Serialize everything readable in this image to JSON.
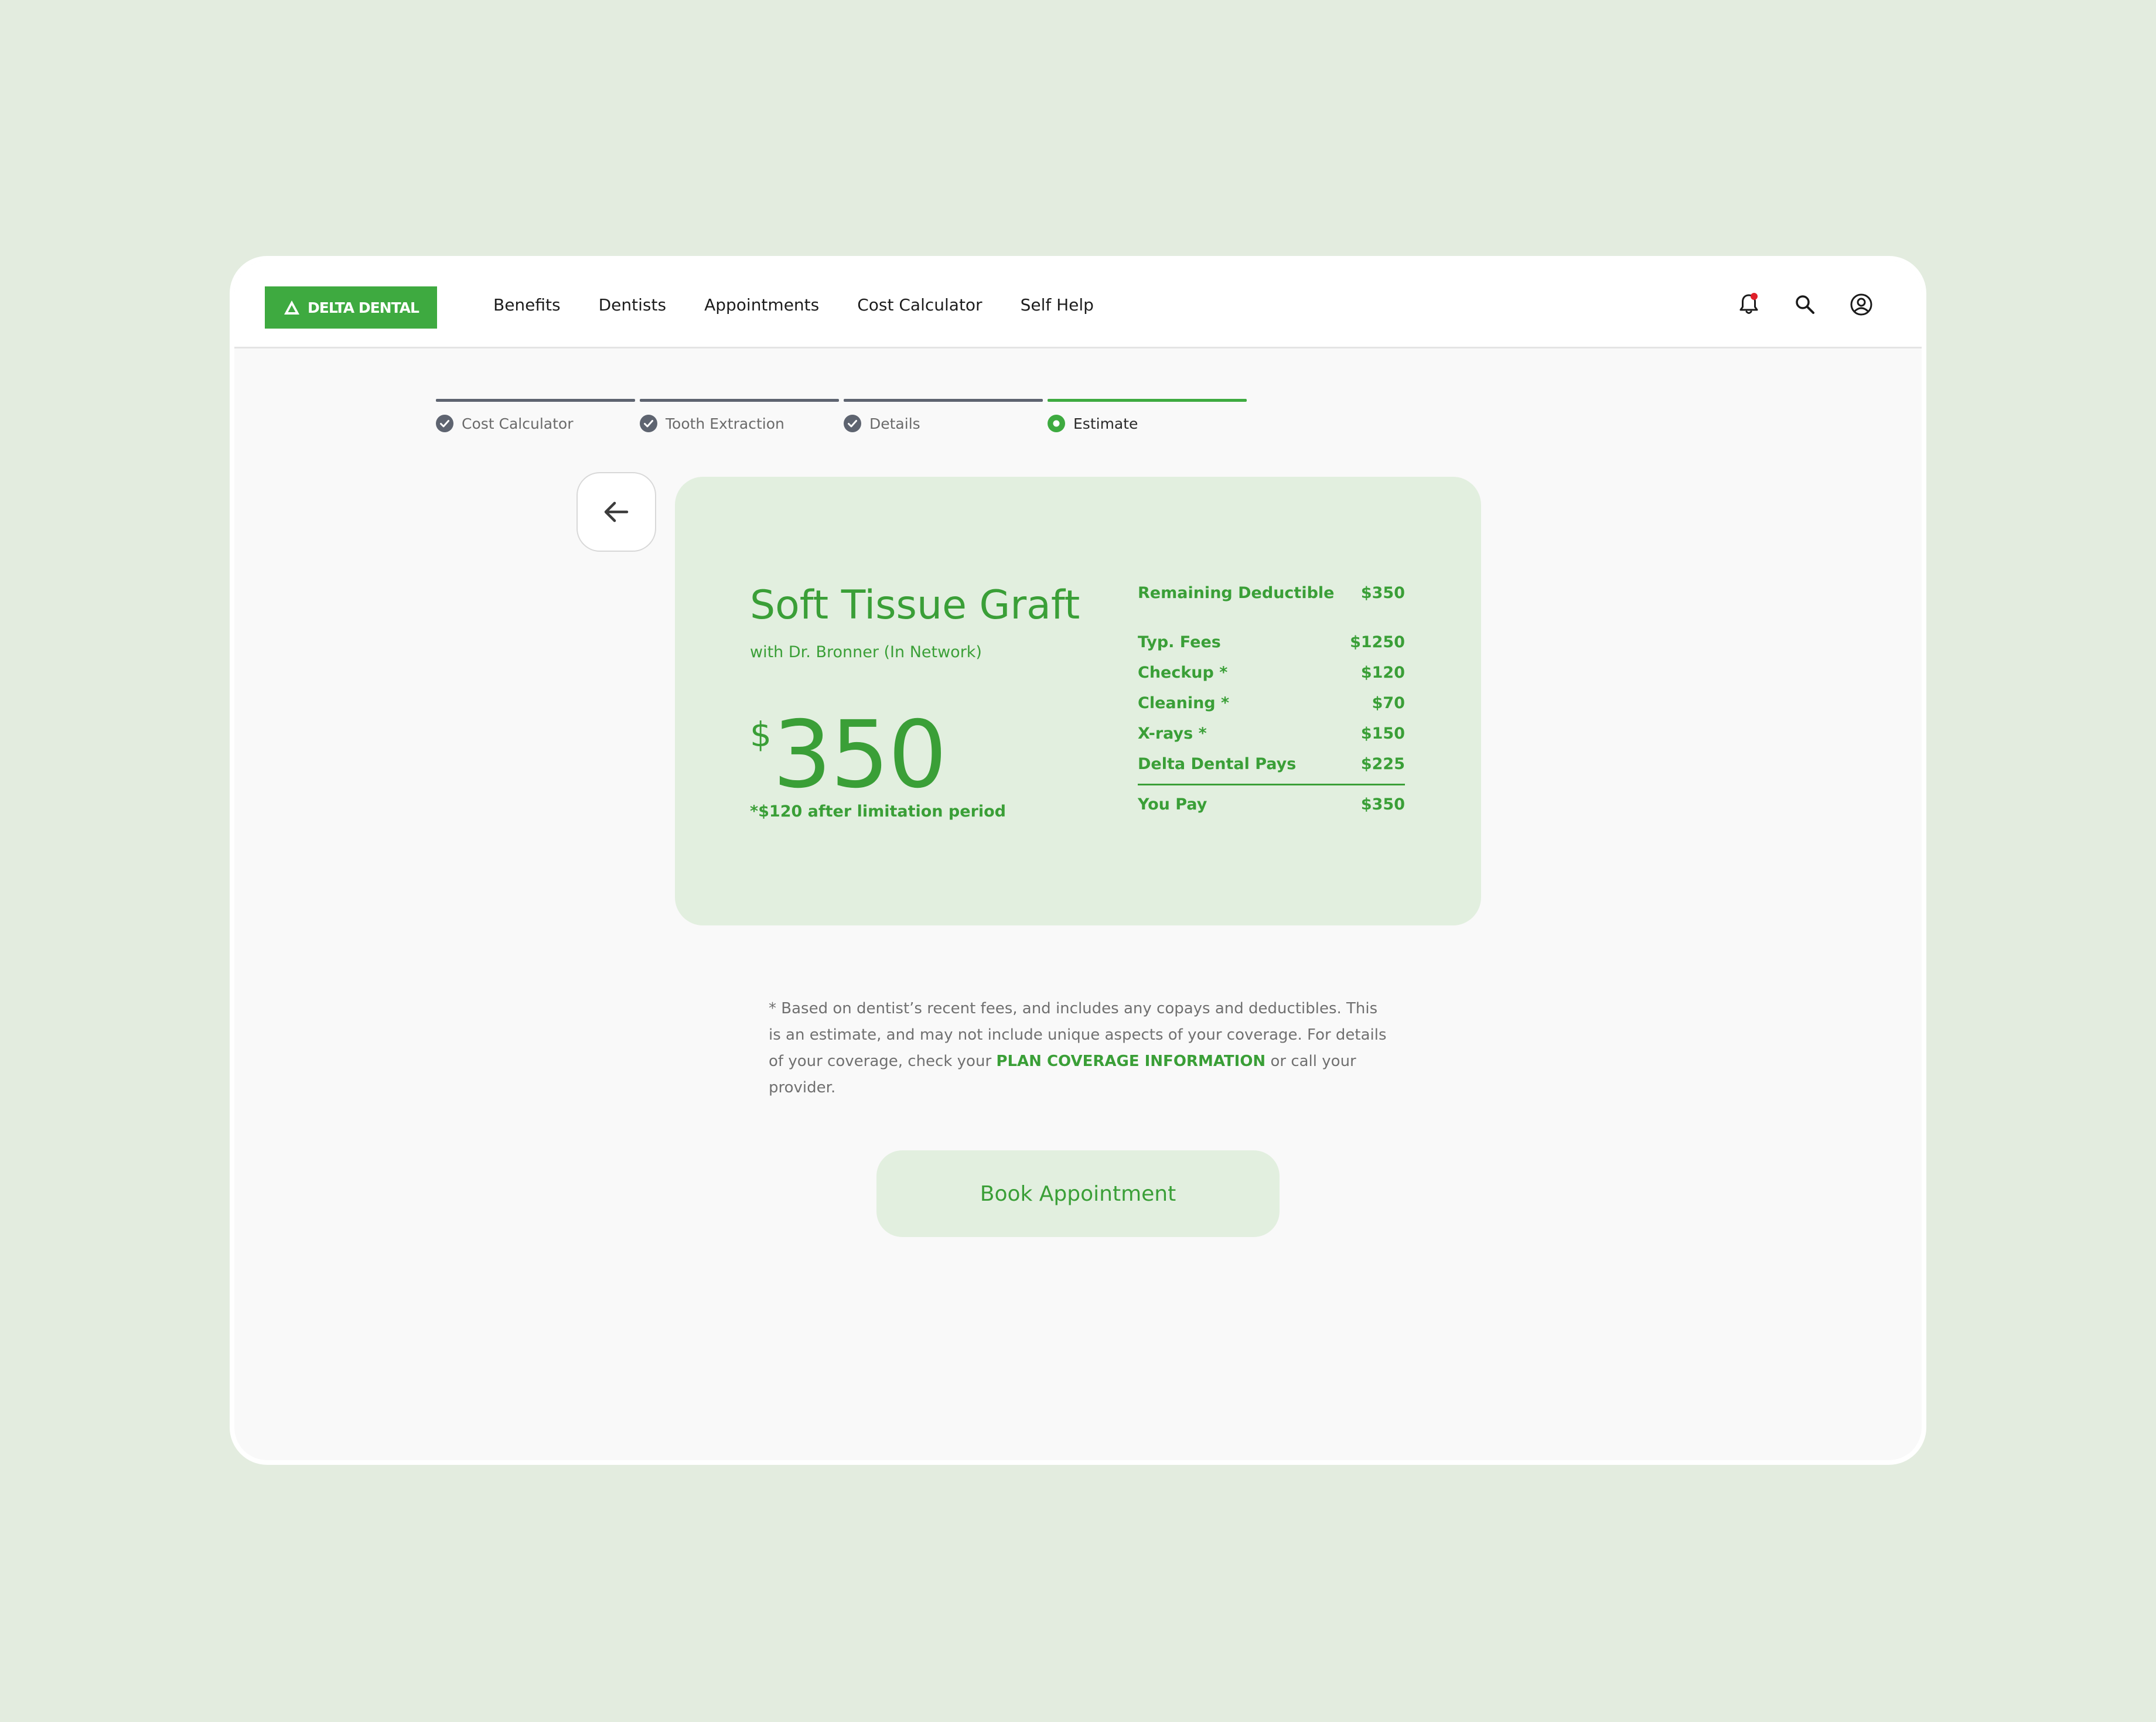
{
  "brand": {
    "name": "DELTA DENTAL",
    "color": "#3eaa40"
  },
  "nav": {
    "items": [
      {
        "label": "Benefits"
      },
      {
        "label": "Dentists"
      },
      {
        "label": "Appointments"
      },
      {
        "label": "Cost Calculator"
      },
      {
        "label": "Self Help"
      }
    ]
  },
  "header_icons": [
    "bell-icon",
    "search-icon",
    "account-icon"
  ],
  "notification": {
    "has_unread": true,
    "dot_color": "#e0202a"
  },
  "stepper": {
    "steps": [
      {
        "label": "Cost Calculator",
        "state": "complete"
      },
      {
        "label": "Tooth Extraction",
        "state": "complete"
      },
      {
        "label": "Details",
        "state": "complete"
      },
      {
        "label": "Estimate",
        "state": "current"
      }
    ]
  },
  "estimate": {
    "procedure": "Soft Tissue Graft",
    "provider": "with Dr. Bronner (In Network)",
    "currency": "$",
    "amount": "350",
    "limitation_note": "*$120 after limitation period",
    "breakdown": {
      "remaining_deductible": {
        "label": "Remaining Deductible",
        "value": "$350"
      },
      "rows": [
        {
          "label": "Typ. Fees",
          "value": "$1250"
        },
        {
          "label": "Checkup *",
          "value": "$120"
        },
        {
          "label": "Cleaning *",
          "value": "$70"
        },
        {
          "label": "X-rays *",
          "value": "$150"
        },
        {
          "label": "Delta Dental Pays",
          "value": "$225"
        }
      ],
      "total": {
        "label": "You Pay",
        "value": "$350"
      }
    }
  },
  "disclaimer": {
    "text_before": "* Based on dentist’s recent fees, and includes any copays and deductibles. This is an estimate, and may not include unique aspects of your coverage. For details of your coverage, check your ",
    "link": "PLAN COVERAGE INFORMATION",
    "text_after": " or call your provider."
  },
  "cta": {
    "label": "Book Appointment"
  },
  "colors": {
    "accent": "#3eaa40",
    "card_bg": "#e2efdf",
    "page_bg": "#e3ecdf"
  }
}
